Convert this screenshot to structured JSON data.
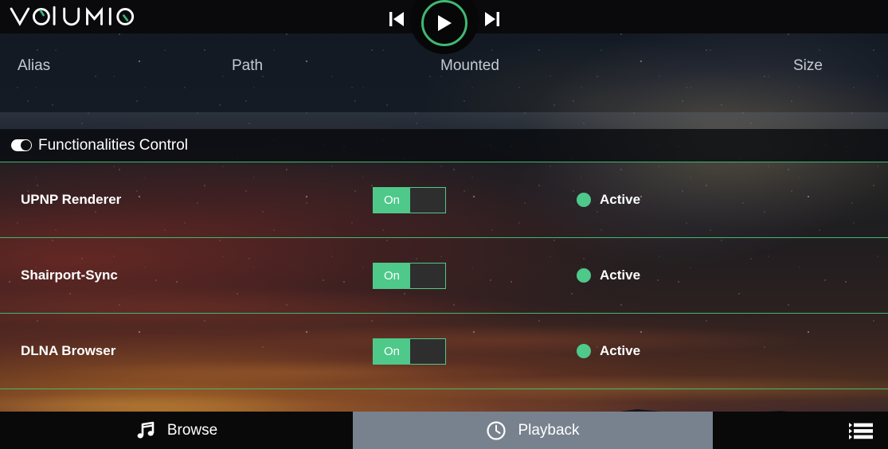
{
  "app": {
    "name": "Volumio",
    "logo_text": "VOLUMIO"
  },
  "player": {
    "previous_label": "Previous",
    "previous_icon": "skip-previous-icon",
    "play_label": "Play",
    "play_icon": "play-icon",
    "next_label": "Next",
    "next_icon": "skip-next-icon"
  },
  "table": {
    "columns": [
      {
        "label": "Alias"
      },
      {
        "label": "Path"
      },
      {
        "label": "Mounted"
      },
      {
        "label": "Size"
      }
    ],
    "rows": []
  },
  "section": {
    "icon": "toggle-switch-icon",
    "title": "Functionalities Control"
  },
  "settings": [
    {
      "label": "UPNP Renderer",
      "switch_state": "On",
      "status": "Active",
      "status_color": "#4ec98a"
    },
    {
      "label": "Shairport-Sync",
      "switch_state": "On",
      "status": "Active",
      "status_color": "#4ec98a"
    },
    {
      "label": "DLNA Browser",
      "switch_state": "On",
      "status": "Active",
      "status_color": "#4ec98a"
    }
  ],
  "bottom_nav": {
    "browse": {
      "label": "Browse",
      "icon": "music-note-icon"
    },
    "playback": {
      "label": "Playback",
      "icon": "clock-icon",
      "active": true
    },
    "queue": {
      "label": "Queue",
      "icon": "playlist-queue-icon"
    }
  },
  "colors": {
    "accent_green": "#4ec98a",
    "play_ring": "#3fb873",
    "topbar": "#0a0a0c",
    "playback_tab": "#78828e"
  }
}
